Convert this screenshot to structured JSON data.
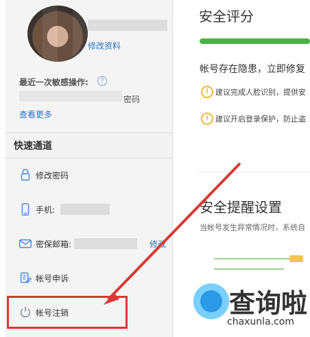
{
  "sidebar": {
    "edit_profile": "修改资料",
    "recent_sensitive_label": "最近一次敏感操作:",
    "recent_sensitive_value_suffix": "密码",
    "view_more": "查看更多",
    "quick_access_title": "快速通道",
    "items": [
      {
        "label": "修改密码"
      },
      {
        "label": "手机:"
      },
      {
        "label": "密保邮箱:",
        "action": "修改"
      },
      {
        "label": "帐号申诉"
      },
      {
        "label": "帐号注销"
      }
    ]
  },
  "main": {
    "security_score_title": "安全评分",
    "security_score_progress": 1.0,
    "warning_text": "帐号存在隐患，立即修复",
    "tips": [
      "建议完成人脸识别，提供安",
      "建议开启登录保护，防止盗"
    ],
    "reminder_title": "安全提醒设置",
    "reminder_desc": "当帐号发生异常情况时，系统自"
  },
  "watermark": {
    "text_cn": "查询啦",
    "text_en": "chaxunla.com"
  },
  "colors": {
    "accent_green": "#48b245",
    "link_blue": "#2b76c3",
    "warn_orange": "#f0b63a",
    "highlight_red": "#d83a35"
  }
}
